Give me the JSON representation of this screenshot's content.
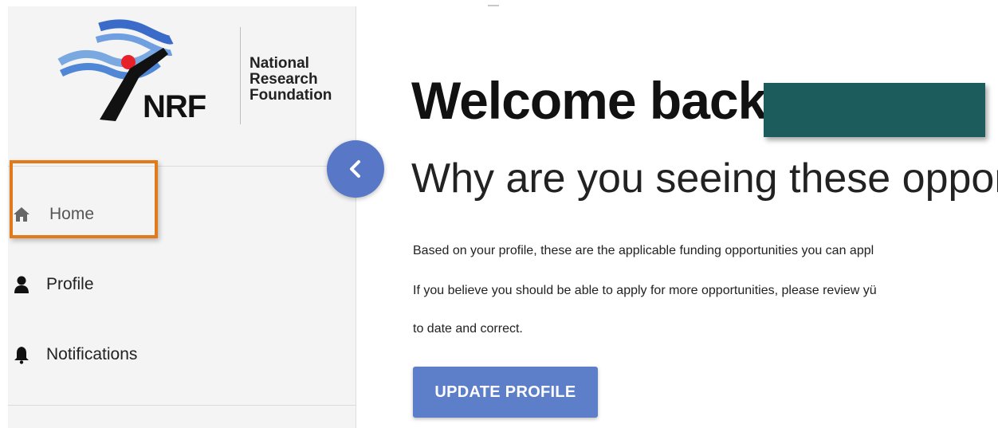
{
  "logo": {
    "initials": "NRF",
    "line1": "National",
    "line2": "Research",
    "line3": "Foundation"
  },
  "sidebar": {
    "items": [
      {
        "label": "Home",
        "icon": "home-icon"
      },
      {
        "label": "Profile",
        "icon": "user-icon"
      },
      {
        "label": "Notifications",
        "icon": "bell-icon"
      }
    ],
    "highlight_color": "#e07a1a"
  },
  "main": {
    "welcome": "Welcome back,",
    "subtitle": "Why are you seeing these opportur",
    "para_line1": "Based on your profile, these are the applicable funding opportunities you can appl",
    "para_line2": "If you believe you should be able to apply for more opportunities, please review yü",
    "para_line3": "to date and correct.",
    "update_button": "UPDATE PROFILE"
  },
  "colors": {
    "accent": "#5878c7",
    "button": "#5d7fca",
    "redaction": "#1c5c5c"
  }
}
